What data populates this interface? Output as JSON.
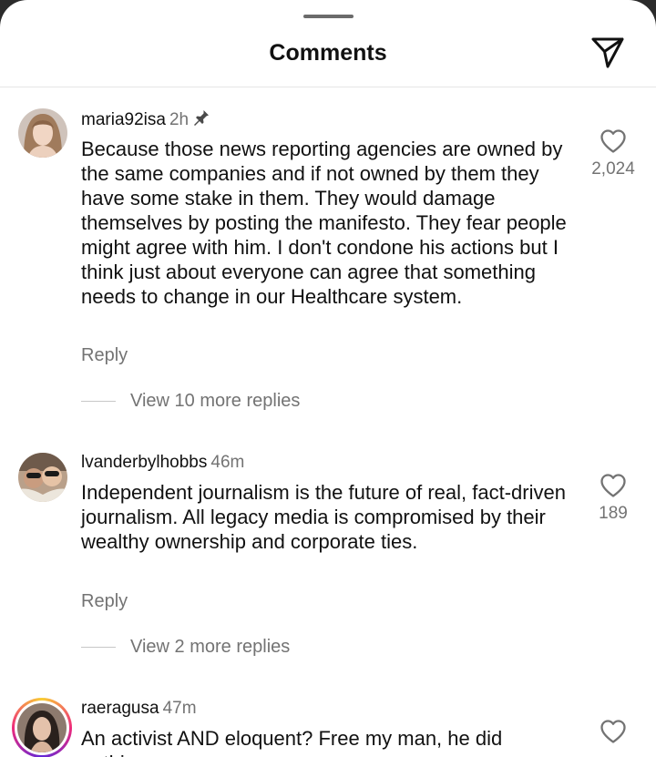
{
  "header": {
    "title": "Comments",
    "share_icon": "send-icon"
  },
  "comments": [
    {
      "username": "maria92isa",
      "time": "2h",
      "pinned": true,
      "text": "Because those news reporting agencies are owned by the same companies and if not owned by them they have some stake in them. They would damage themselves by posting the manifesto. They fear people might agree with him. I don't condone his actions but I think just about everyone can agree that something needs to change in our Healthcare system.",
      "reply_label": "Reply",
      "view_replies": "View 10 more replies",
      "likes": "2,024"
    },
    {
      "username": "lvanderbylhobbs",
      "time": "46m",
      "pinned": false,
      "text": "Independent journalism is the future of real, fact-driven journalism. All legacy media is compromised by their wealthy ownership and corporate ties.",
      "reply_label": "Reply",
      "view_replies": "View 2 more replies",
      "likes": "189"
    },
    {
      "username": "raeragusa",
      "time": "47m",
      "pinned": false,
      "text": "An activist AND eloquent? Free my man, he did nothing",
      "has_story": true
    }
  ],
  "colors": {
    "background": "#ffffff",
    "text": "#111111",
    "secondary_text": "#737373",
    "divider": "#e6e6e6"
  }
}
